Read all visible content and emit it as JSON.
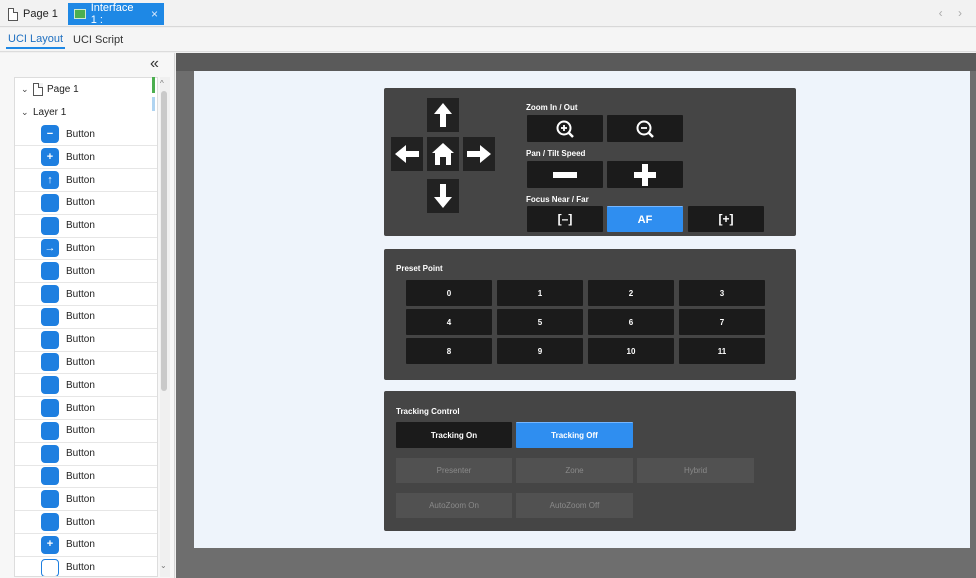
{
  "doc_tabs": [
    {
      "label": "Page 1"
    },
    {
      "label": "Interface 1 :",
      "close": "×"
    }
  ],
  "nav_arrows": "‹ ›",
  "sub_tabs": [
    {
      "label": "UCI Layout",
      "active": true
    },
    {
      "label": "UCI Script",
      "active": false
    }
  ],
  "left_panel": {
    "collapse_glyph": "«",
    "tree": {
      "page_label": "Page 1",
      "layer_label": "Layer 1",
      "items": [
        {
          "label": "Button",
          "icon": "zoom-out-icon"
        },
        {
          "label": "Button",
          "icon": "zoom-in-icon"
        },
        {
          "label": "Button",
          "icon": "arrow-up-icon"
        },
        {
          "label": "Button",
          "icon": "blank-blue-icon"
        },
        {
          "label": "Button",
          "icon": "blank-blue-icon"
        },
        {
          "label": "Button",
          "icon": "arrow-right-icon"
        },
        {
          "label": "Button",
          "icon": "blank-blue-icon"
        },
        {
          "label": "Button",
          "icon": "blank-blue-icon"
        },
        {
          "label": "Button",
          "icon": "blank-blue-icon"
        },
        {
          "label": "Button",
          "icon": "blank-blue-icon"
        },
        {
          "label": "Button",
          "icon": "blank-blue-icon"
        },
        {
          "label": "Button",
          "icon": "blank-blue-icon"
        },
        {
          "label": "Button",
          "icon": "blank-blue-icon"
        },
        {
          "label": "Button",
          "icon": "blank-blue-icon"
        },
        {
          "label": "Button",
          "icon": "blank-blue-icon"
        },
        {
          "label": "Button",
          "icon": "blank-blue-icon"
        },
        {
          "label": "Button",
          "icon": "blank-blue-icon"
        },
        {
          "label": "Button",
          "icon": "blank-blue-icon"
        },
        {
          "label": "Button",
          "icon": "plus-icon"
        },
        {
          "label": "Button",
          "icon": "blank-white-icon"
        },
        {
          "label": "",
          "icon": "blank-blue-icon"
        }
      ]
    }
  },
  "ptz_panel": {
    "zoom_label": "Zoom In / Out",
    "pan_tilt_label": "Pan / Tilt Speed",
    "focus_label": "Focus Near / Far",
    "focus_auto_label": "AF",
    "focus_near_label": "[–]",
    "focus_far_label": "[+]"
  },
  "preset_panel": {
    "title": "Preset Point",
    "presets": [
      "0",
      "1",
      "2",
      "3",
      "4",
      "5",
      "6",
      "7",
      "8",
      "9",
      "10",
      "11"
    ]
  },
  "tracking_panel": {
    "title": "Tracking Control",
    "tracking_on": "Tracking On",
    "tracking_off": "Tracking Off",
    "presenter": "Presenter",
    "zone": "Zone",
    "hybrid": "Hybrid",
    "autozoom_on": "AutoZoom On",
    "autozoom_off": "AutoZoom Off"
  },
  "colors": {
    "accent": "#1e88e5",
    "panel_bg": "#454545",
    "button_dark": "#1b1b1b",
    "button_blue": "#2f8ef0",
    "canvas_bg": "#6e6e6e",
    "page_bg": "#eef4fb"
  }
}
